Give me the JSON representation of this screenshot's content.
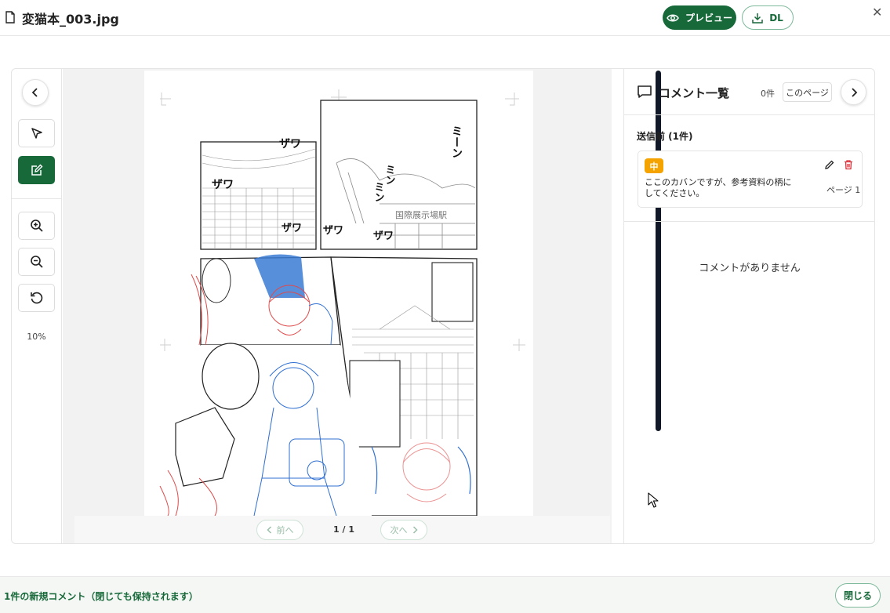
{
  "header": {
    "file_name": "変猫本_003.jpg",
    "preview_label": "プレビュー",
    "download_label": "DL",
    "close_label": "✕"
  },
  "toolbar": {
    "zoom_level": "10%",
    "tools": [
      "back",
      "select",
      "annotate",
      "zoom-in",
      "zoom-out",
      "reset"
    ]
  },
  "canvas": {
    "artwork": {
      "sound_effects": [
        "ザワ",
        "ザワ",
        "ミーン",
        "ミン",
        "ミン",
        "ザワ",
        "ザワ",
        "ザワ"
      ],
      "sign_text": "国際展示場駅"
    }
  },
  "pager": {
    "prev_label": "前へ",
    "next_label": "次へ",
    "page_count": "1 / 1"
  },
  "comments": {
    "title": "コメント一覧",
    "count": "0件",
    "this_page_label": "このページ",
    "section_title": "送信前 (1件)",
    "items": [
      {
        "priority": "中",
        "text": "ここのカバンですが、参考資料の柄にしてください。",
        "page": "ページ 1"
      }
    ],
    "empty_text": "コメントがありません"
  },
  "footer": {
    "status_text": "1件の新規コメント（閉じても保持されます）",
    "close_label": "閉じる"
  },
  "colors": {
    "accent": "#17693a",
    "badge": "#f5a300",
    "scrollbar": "#111827"
  }
}
